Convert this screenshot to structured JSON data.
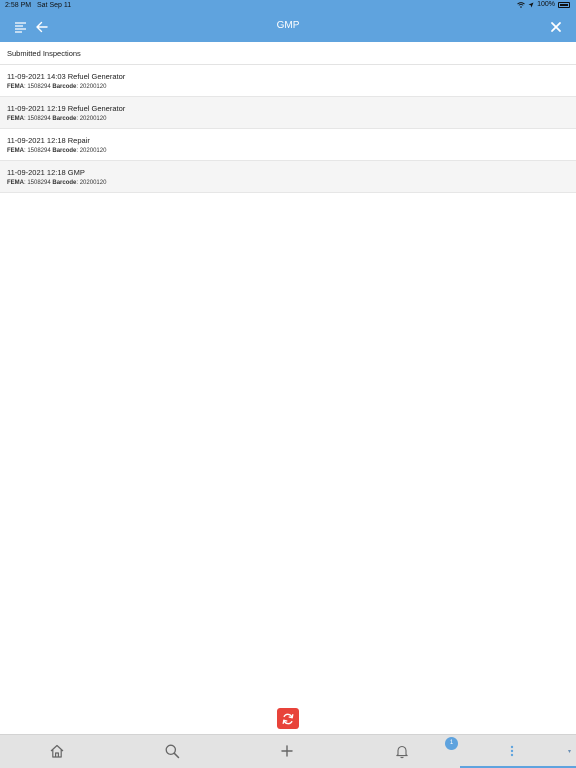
{
  "status": {
    "time": "2:58 PM",
    "date": "Sat Sep 11",
    "battery": "100%"
  },
  "nav": {
    "title": "GMP"
  },
  "section": {
    "title": "Submitted Inspections"
  },
  "inspections": [
    {
      "title": "11-09-2021 14:03 Refuel Generator",
      "fema_label": "FEMA",
      "fema": ": 1508294",
      "barcode_label": "Barcode",
      "barcode": ": 20200120"
    },
    {
      "title": "11-09-2021 12:19 Refuel Generator",
      "fema_label": "FEMA",
      "fema": ": 1508294",
      "barcode_label": "Barcode",
      "barcode": ": 20200120"
    },
    {
      "title": "11-09-2021 12:18 Repair",
      "fema_label": "FEMA",
      "fema": ": 1508294",
      "barcode_label": "Barcode",
      "barcode": ": 20200120"
    },
    {
      "title": "11-09-2021 12:18 GMP",
      "fema_label": "FEMA",
      "fema": ": 1508294",
      "barcode_label": "Barcode",
      "barcode": ": 20200120"
    }
  ],
  "tabbar": {
    "badge": "1"
  },
  "colors": {
    "accent": "#5fa3de",
    "refresh": "#e8433a",
    "tabbar_bg": "#e3e3e3"
  },
  "icons": [
    "menu-icon",
    "back-arrow-icon",
    "close-icon",
    "refresh-icon",
    "home-icon",
    "search-icon",
    "plus-icon",
    "bell-icon",
    "more-vertical-icon"
  ]
}
